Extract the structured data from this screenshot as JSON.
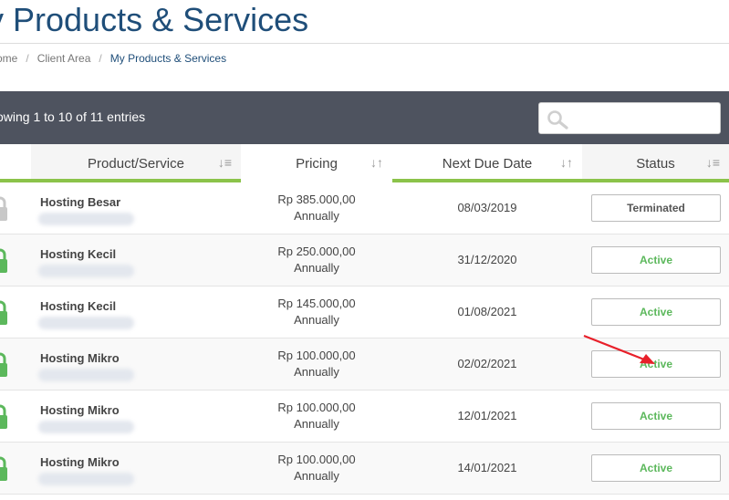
{
  "page": {
    "title": "y Products & Services"
  },
  "breadcrumb": {
    "items": [
      "ome",
      "Client Area",
      "My Products & Services"
    ],
    "separator": "/"
  },
  "toolbar": {
    "entries_info": "owing 1 to 10 of 11 entries",
    "search_placeholder": ""
  },
  "table": {
    "headers": {
      "product": "Product/Service",
      "pricing": "Pricing",
      "due": "Next Due Date",
      "status": "Status"
    },
    "rows": [
      {
        "name": "Hosting Besar",
        "price": "Rp 385.000,00",
        "cycle": "Annually",
        "due": "08/03/2019",
        "status": "Terminated",
        "lock_color": "#c8c8c8"
      },
      {
        "name": "Hosting Kecil",
        "price": "Rp 250.000,00",
        "cycle": "Annually",
        "due": "31/12/2020",
        "status": "Active",
        "lock_color": "#5cb85c"
      },
      {
        "name": "Hosting Kecil",
        "price": "Rp 145.000,00",
        "cycle": "Annually",
        "due": "01/08/2021",
        "status": "Active",
        "lock_color": "#5cb85c"
      },
      {
        "name": "Hosting Mikro",
        "price": "Rp 100.000,00",
        "cycle": "Annually",
        "due": "02/02/2021",
        "status": "Active",
        "lock_color": "#5cb85c"
      },
      {
        "name": "Hosting Mikro",
        "price": "Rp 100.000,00",
        "cycle": "Annually",
        "due": "12/01/2021",
        "status": "Active",
        "lock_color": "#5cb85c"
      },
      {
        "name": "Hosting Mikro",
        "price": "Rp 100.000,00",
        "cycle": "Annually",
        "due": "14/01/2021",
        "status": "Active",
        "lock_color": "#5cb85c"
      }
    ]
  },
  "colors": {
    "title": "#1f4e79",
    "toolbar_bg": "#4e535f",
    "header_accent": "#8bc34a",
    "active": "#5cb85c",
    "annotation_arrow": "#e8202a"
  },
  "icons": {
    "search": "search-icon",
    "lock": "lock-icon",
    "sort": "sort-icon",
    "annotation": "red-arrow-annotation"
  }
}
